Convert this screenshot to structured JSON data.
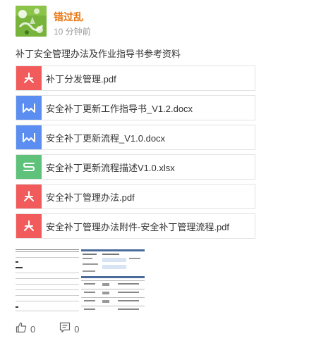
{
  "post": {
    "author": "错过乱",
    "time": "10 分钟前",
    "text": "补丁安全管理办法及作业指导书参考资料"
  },
  "files": [
    {
      "name": "补丁分发管理.pdf",
      "type": "pdf",
      "color": "#f25b5b"
    },
    {
      "name": "安全补丁更新工作指导书_V1.2.docx",
      "type": "docx",
      "color": "#5b8ef0"
    },
    {
      "name": "安全补丁更新流程_V1.0.docx",
      "type": "docx",
      "color": "#5b8ef0"
    },
    {
      "name": "安全补丁更新流程描述V1.0.xlsx",
      "type": "xlsx",
      "color": "#5ec27a"
    },
    {
      "name": "安全补丁管理办法.pdf",
      "type": "pdf",
      "color": "#f25b5b"
    },
    {
      "name": "安全补丁管理办法附件-安全补丁管理流程.pdf",
      "type": "pdf",
      "color": "#f25b5b"
    }
  ],
  "actions": {
    "like_count": "0",
    "comment_count": "0"
  },
  "icons": {
    "like": "thumbs-up-icon",
    "comment": "comment-icon",
    "pdf": "pdf-icon",
    "docx": "word-icon",
    "xlsx": "excel-icon"
  },
  "colors": {
    "author": "#e8710a",
    "avatar": "#6aa832",
    "pdf": "#f25b5b",
    "word": "#5b8ef0",
    "excel": "#5ec27a"
  }
}
